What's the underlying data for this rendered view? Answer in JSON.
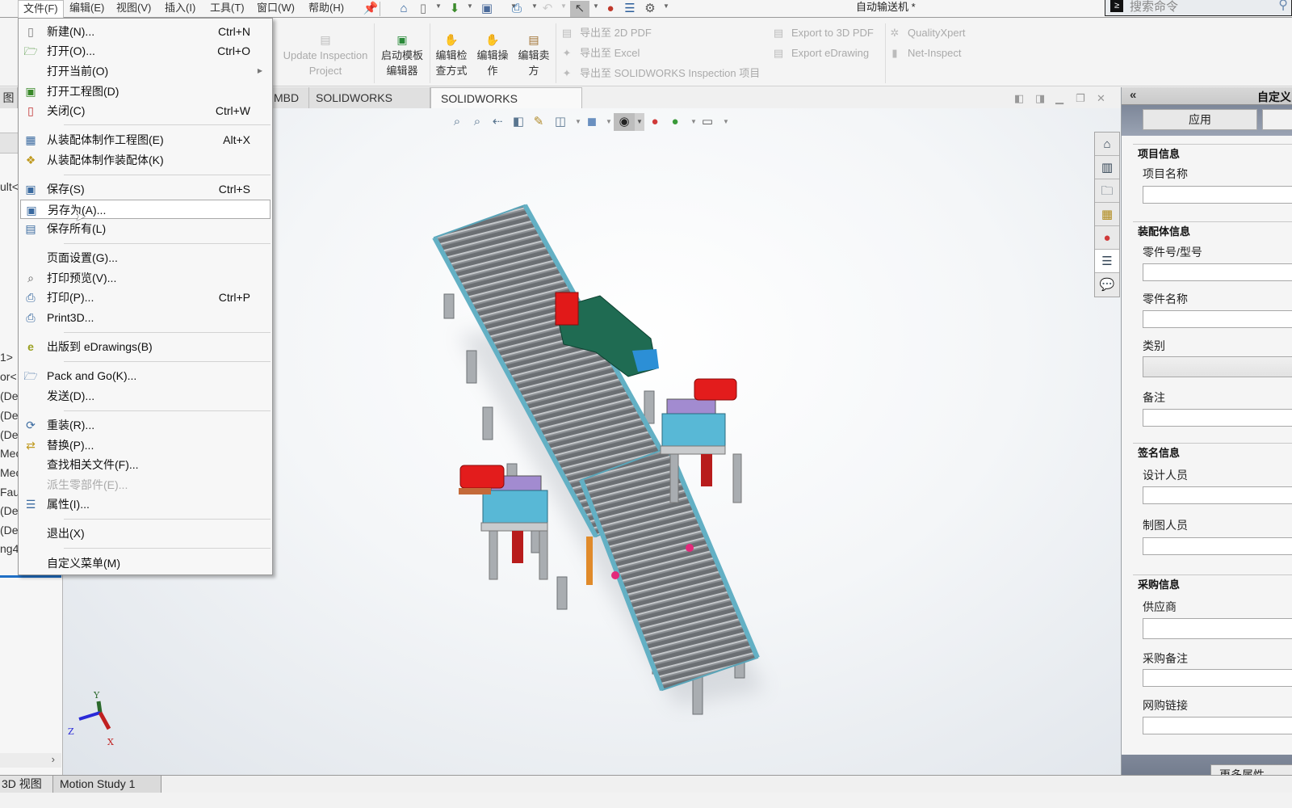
{
  "menubar": {
    "items": [
      "文件(F)",
      "编辑(E)",
      "视图(V)",
      "插入(I)",
      "工具(T)",
      "窗口(W)",
      "帮助(H)"
    ],
    "open_menu": "文件(F)",
    "pin_icon": "pin-icon"
  },
  "window": {
    "title": "自动输送机 *"
  },
  "search": {
    "placeholder": "搜索命令"
  },
  "ribbon": {
    "update_inspection": "Update Inspection Project",
    "update_inspection_l1": "Update Inspection",
    "update_inspection_l2": "Project",
    "launch_template_l1": "启动模板",
    "launch_template_l2": "编辑器",
    "edit_check_l1": "编辑检",
    "edit_check_l2": "查方式",
    "edit_op_l1": "编辑操",
    "edit_op_l2": "作",
    "edit_vendor_l1": "编辑卖",
    "edit_vendor_l2": "方",
    "export_2d_pdf": "导出至 2D PDF",
    "export_excel": "导出至 Excel",
    "export_sw_inspection": "导出至 SOLIDWORKS Inspection 项目",
    "export_3d_pdf": "Export to 3D PDF",
    "export_edrawing": "Export eDrawing",
    "quality_xpert": "QualityXpert",
    "net_inspect": "Net-Inspect"
  },
  "tabs": [
    {
      "label": "图",
      "active": false
    },
    {
      "label": "MBD",
      "active": false
    },
    {
      "label": "SOLIDWORKS CAM",
      "active": false
    },
    {
      "label": "SOLIDWORKS Inspection",
      "active": true
    }
  ],
  "tree_fragments": [
    "ult<",
    "1>",
    "or<",
    "(De",
    "(De",
    "(De",
    "Mec",
    "Mec",
    "Faul",
    "(De",
    "(De",
    "ng4"
  ],
  "file_menu": {
    "items": [
      {
        "label": "新建(N)...",
        "shortcut": "Ctrl+N",
        "icon": "new-document-icon"
      },
      {
        "label": "打开(O)...",
        "shortcut": "Ctrl+O",
        "icon": "open-folder-icon"
      },
      {
        "label": "打开当前(O)",
        "shortcut": "",
        "icon": "",
        "submenu": true
      },
      {
        "label": "打开工程图(D)",
        "shortcut": "",
        "icon": "open-drawing-icon"
      },
      {
        "label": "关闭(C)",
        "shortcut": "Ctrl+W",
        "icon": "close-document-icon"
      },
      {
        "label": "从装配体制作工程图(E)",
        "shortcut": "Alt+X",
        "icon": "make-drawing-icon"
      },
      {
        "label": "从装配体制作装配体(K)",
        "shortcut": "",
        "icon": "make-assembly-icon"
      },
      {
        "label": "保存(S)",
        "shortcut": "Ctrl+S",
        "icon": "save-icon"
      },
      {
        "label": "另存为(A)...",
        "shortcut": "",
        "icon": "save-as-icon",
        "hovered": true
      },
      {
        "label": "保存所有(L)",
        "shortcut": "",
        "icon": "save-all-icon"
      },
      {
        "label": "页面设置(G)...",
        "shortcut": "",
        "icon": ""
      },
      {
        "label": "打印预览(V)...",
        "shortcut": "",
        "icon": "print-preview-icon"
      },
      {
        "label": "打印(P)...",
        "shortcut": "Ctrl+P",
        "icon": "printer-icon"
      },
      {
        "label": "Print3D...",
        "shortcut": "",
        "icon": "print3d-icon"
      },
      {
        "label": "出版到 eDrawings(B)",
        "shortcut": "",
        "icon": "edrawings-icon"
      },
      {
        "label": "Pack and Go(K)...",
        "shortcut": "",
        "icon": "pack-and-go-icon"
      },
      {
        "label": "发送(D)...",
        "shortcut": "",
        "icon": ""
      },
      {
        "label": "重装(R)...",
        "shortcut": "",
        "icon": "reload-icon"
      },
      {
        "label": "替换(P)...",
        "shortcut": "",
        "icon": "replace-icon"
      },
      {
        "label": "查找相关文件(F)...",
        "shortcut": "",
        "icon": ""
      },
      {
        "label": "派生零部件(E)...",
        "shortcut": "",
        "icon": "",
        "disabled": true
      },
      {
        "label": "属性(I)...",
        "shortcut": "",
        "icon": "properties-icon"
      },
      {
        "label": "退出(X)",
        "shortcut": "",
        "icon": ""
      },
      {
        "label": "自定义菜单(M)",
        "shortcut": "",
        "icon": ""
      }
    ]
  },
  "viewport": {
    "triad": {
      "x": "X",
      "y": "Y",
      "z": "Z"
    }
  },
  "right_panel": {
    "title": "自定义",
    "apply_label": "应用",
    "more_label": "更多属性",
    "sections": [
      {
        "title": "项目信息",
        "fields": [
          {
            "label": "项目名称",
            "value": ""
          }
        ]
      },
      {
        "title": "装配体信息",
        "fields": [
          {
            "label": "零件号/型号",
            "value": ""
          },
          {
            "label": "零件名称",
            "value": ""
          },
          {
            "label": "类别",
            "value": "",
            "type": "select"
          },
          {
            "label": "备注",
            "value": ""
          }
        ]
      },
      {
        "title": "签名信息",
        "fields": [
          {
            "label": "设计人员",
            "value": ""
          },
          {
            "label": "制图人员",
            "value": ""
          }
        ]
      },
      {
        "title": "采购信息",
        "fields": [
          {
            "label": "供应商",
            "value": ""
          },
          {
            "label": "采购备注",
            "value": ""
          },
          {
            "label": "网购链接",
            "value": ""
          }
        ]
      }
    ]
  },
  "side_tabs": [
    "home-icon",
    "parts-library-icon",
    "file-explorer-icon",
    "view-palette-icon",
    "appearances-icon",
    "custom-properties-icon",
    "forum-icon"
  ],
  "status_tabs": [
    "3D 视图",
    "Motion Study 1"
  ]
}
